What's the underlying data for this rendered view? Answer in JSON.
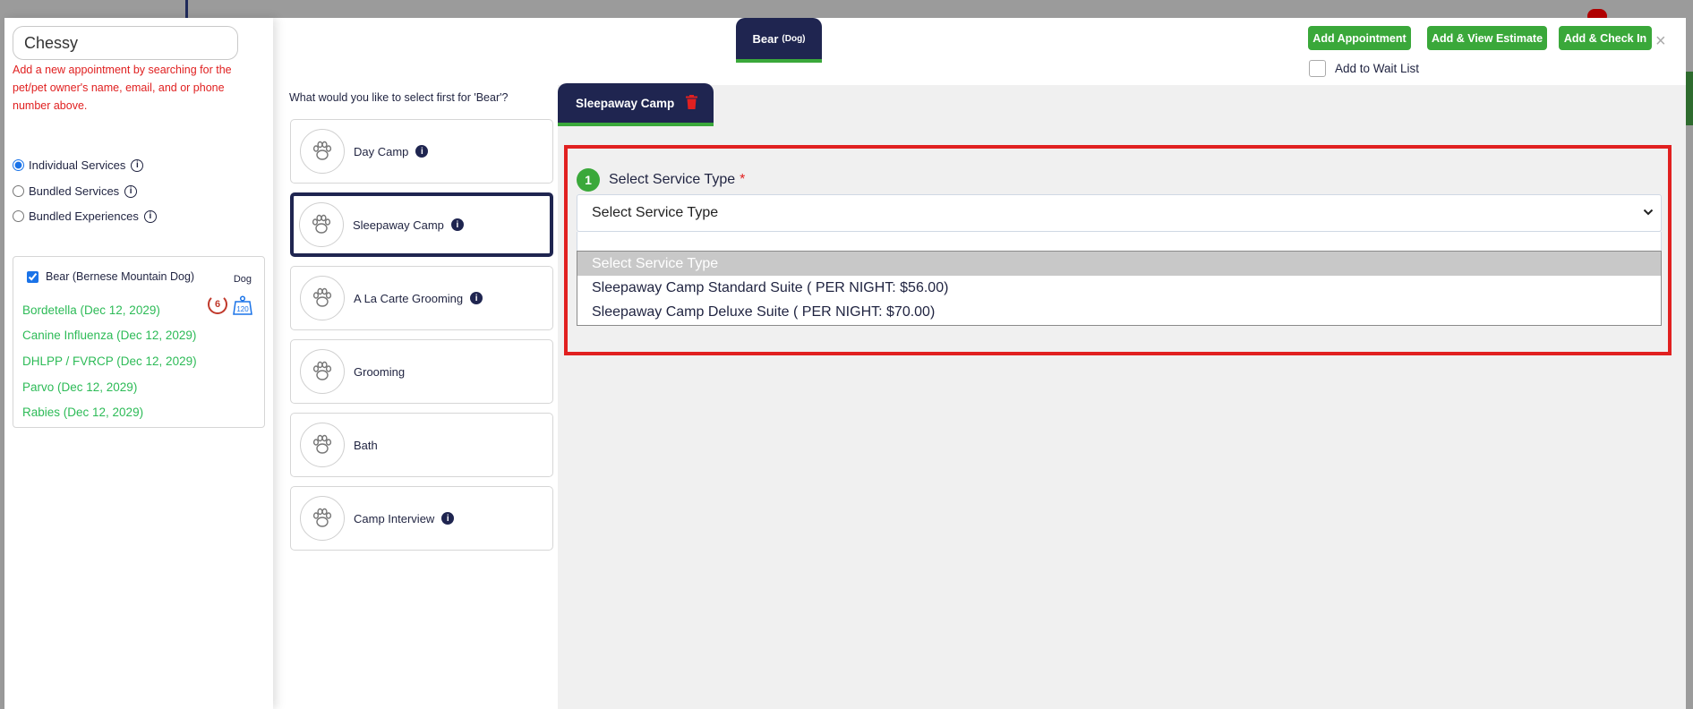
{
  "search": {
    "value": "Chessy"
  },
  "hint": "Add a new appointment by searching for the pet/pet owner's name, email, and or phone number above.",
  "service_mode": {
    "options": [
      {
        "label": "Individual Services",
        "checked": true
      },
      {
        "label": "Bundled Services",
        "checked": false
      },
      {
        "label": "Bundled Experiences",
        "checked": false
      }
    ]
  },
  "pet": {
    "name": "Bear (Bernese Mountain Dog)",
    "species": "Dog",
    "visit_count": "6",
    "weight": "120",
    "vaccines": [
      "Bordetella (Dec 12, 2029)",
      "Canine Influenza (Dec 12, 2029)",
      "DHLPP / FVRCP (Dec 12, 2029)",
      "Parvo (Dec 12, 2029)",
      "Rabies (Dec 12, 2029)"
    ]
  },
  "question": "What would you like to select first for 'Bear'?",
  "services": [
    {
      "label": "Day Camp",
      "info": true,
      "selected": false
    },
    {
      "label": "Sleepaway Camp",
      "info": true,
      "selected": true
    },
    {
      "label": "A La Carte Grooming",
      "info": true,
      "selected": false
    },
    {
      "label": "Grooming",
      "info": false,
      "selected": false
    },
    {
      "label": "Bath",
      "info": false,
      "selected": false
    },
    {
      "label": "Camp Interview",
      "info": true,
      "selected": false
    }
  ],
  "pet_tab": {
    "name": "Bear",
    "species": "(Dog)"
  },
  "actions": {
    "add_appointment": "Add Appointment",
    "add_view_estimate": "Add & View Estimate",
    "add_check_in": "Add & Check In",
    "close": "×"
  },
  "waitlist": {
    "label": "Add to Wait List",
    "checked": false
  },
  "service_tab": {
    "label": "Sleepaway Camp"
  },
  "step": {
    "number": "1",
    "label": "Select Service Type",
    "required_mark": "*"
  },
  "service_type_select": {
    "value": "Select Service Type",
    "options": [
      "Select Service Type",
      "Sleepaway Camp Standard Suite ( PER NIGHT: $56.00)",
      "Sleepaway Camp Deluxe Suite ( PER NIGHT: $70.00)"
    ],
    "highlighted_index": 0
  },
  "colors": {
    "navy": "#1f2550",
    "green": "#3aa83a",
    "vaccine_green": "#2dbb57",
    "red": "#e12020"
  },
  "icons": {
    "service": "paw-icon",
    "info": "info-icon",
    "delete": "trash-icon"
  }
}
